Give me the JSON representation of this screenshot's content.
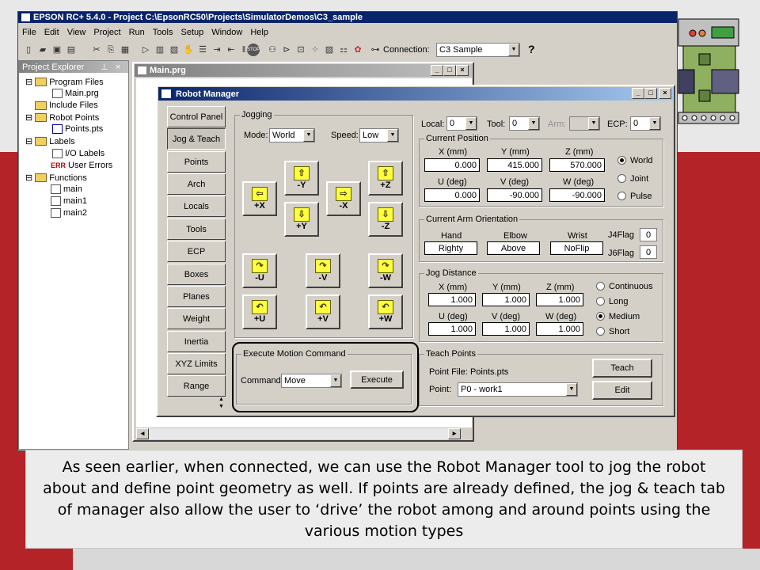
{
  "app": {
    "title": "EPSON RC+ 5.4.0 - Project C:\\EpsonRC50\\Projects\\SimulatorDemos\\C3_sample"
  },
  "menu": [
    "File",
    "Edit",
    "View",
    "Project",
    "Run",
    "Tools",
    "Setup",
    "Window",
    "Help"
  ],
  "toolbar": {
    "connection_label": "Connection:",
    "connection_value": "C3 Sample",
    "help": "?"
  },
  "explorer": {
    "title": "Project Explorer",
    "pin": "ᵖ",
    "close": "×",
    "items": [
      "Program Files",
      "Main.prg",
      "Include Files",
      "Robot Points",
      "Points.pts",
      "Labels",
      "I/O Labels",
      "User Errors",
      "Functions",
      "main",
      "main1",
      "main2"
    ]
  },
  "editor": {
    "title": "Main.prg"
  },
  "robot_manager": {
    "title": "Robot Manager",
    "tabs": [
      "Control Panel",
      "Jog & Teach",
      "Points",
      "Arch",
      "Locals",
      "Tools",
      "ECP",
      "Boxes",
      "Planes",
      "Weight",
      "Inertia",
      "XYZ Limits",
      "Range"
    ],
    "jogging": {
      "label": "Jogging",
      "mode_label": "Mode:",
      "mode": "World",
      "speed_label": "Speed:",
      "speed": "Low",
      "buttons": [
        "+X",
        "-Y",
        "+Y",
        "-X",
        "+Z",
        "-Z",
        "-U",
        "-V",
        "-W",
        "+U",
        "+V",
        "+W"
      ],
      "arrows": [
        "⇦",
        "⇧",
        "⇩",
        "⇨",
        "⇧",
        "⇩",
        "↷",
        "↷",
        "↷",
        "↶",
        "↶",
        "↶"
      ]
    },
    "local_label": "Local:",
    "local": "0",
    "tool_label": "Tool:",
    "tool": "0",
    "arm_label": "Arm:",
    "arm": "",
    "ecp_label": "ECP:",
    "ecp": "0",
    "current_position": {
      "label": "Current Position",
      "headers": [
        "X (mm)",
        "Y (mm)",
        "Z (mm)",
        "U (deg)",
        "V (deg)",
        "W (deg)"
      ],
      "values": [
        "0.000",
        "415.000",
        "570.000",
        "0.000",
        "-90.000",
        "-90.000"
      ],
      "modes": [
        "World",
        "Joint",
        "Pulse"
      ]
    },
    "arm_orientation": {
      "label": "Current Arm Orientation",
      "headers": [
        "Hand",
        "Elbow",
        "Wrist"
      ],
      "values": [
        "Righty",
        "Above",
        "NoFlip"
      ],
      "j4_label": "J4Flag",
      "j4": "0",
      "j6_label": "J6Flag",
      "j6": "0"
    },
    "jog_distance": {
      "label": "Jog Distance",
      "headers": [
        "X (mm)",
        "Y (mm)",
        "Z (mm)",
        "U (deg)",
        "V (deg)",
        "W (deg)"
      ],
      "values": [
        "1.000",
        "1.000",
        "1.000",
        "1.000",
        "1.000",
        "1.000"
      ],
      "modes": [
        "Continuous",
        "Long",
        "Medium",
        "Short"
      ]
    },
    "execute": {
      "label": "Execute Motion Command",
      "command_label": "Command:",
      "command": "Move",
      "button": "Execute"
    },
    "teach": {
      "label": "Teach Points",
      "file_label": "Point File: Points.pts",
      "point_label": "Point:",
      "point": "P0 - work1",
      "teach_button": "Teach",
      "edit_button": "Edit"
    }
  },
  "caption": "As seen earlier, when connected, we can use the Robot Manager tool to jog the robot about and define point geometry as well.  If points are already defined, the jog & teach tab of manager also allow the user to ‘drive’ the robot among and around points using the various motion types",
  "colors": {
    "accent_red": "#b42328",
    "titlebar": "#0a246a"
  }
}
